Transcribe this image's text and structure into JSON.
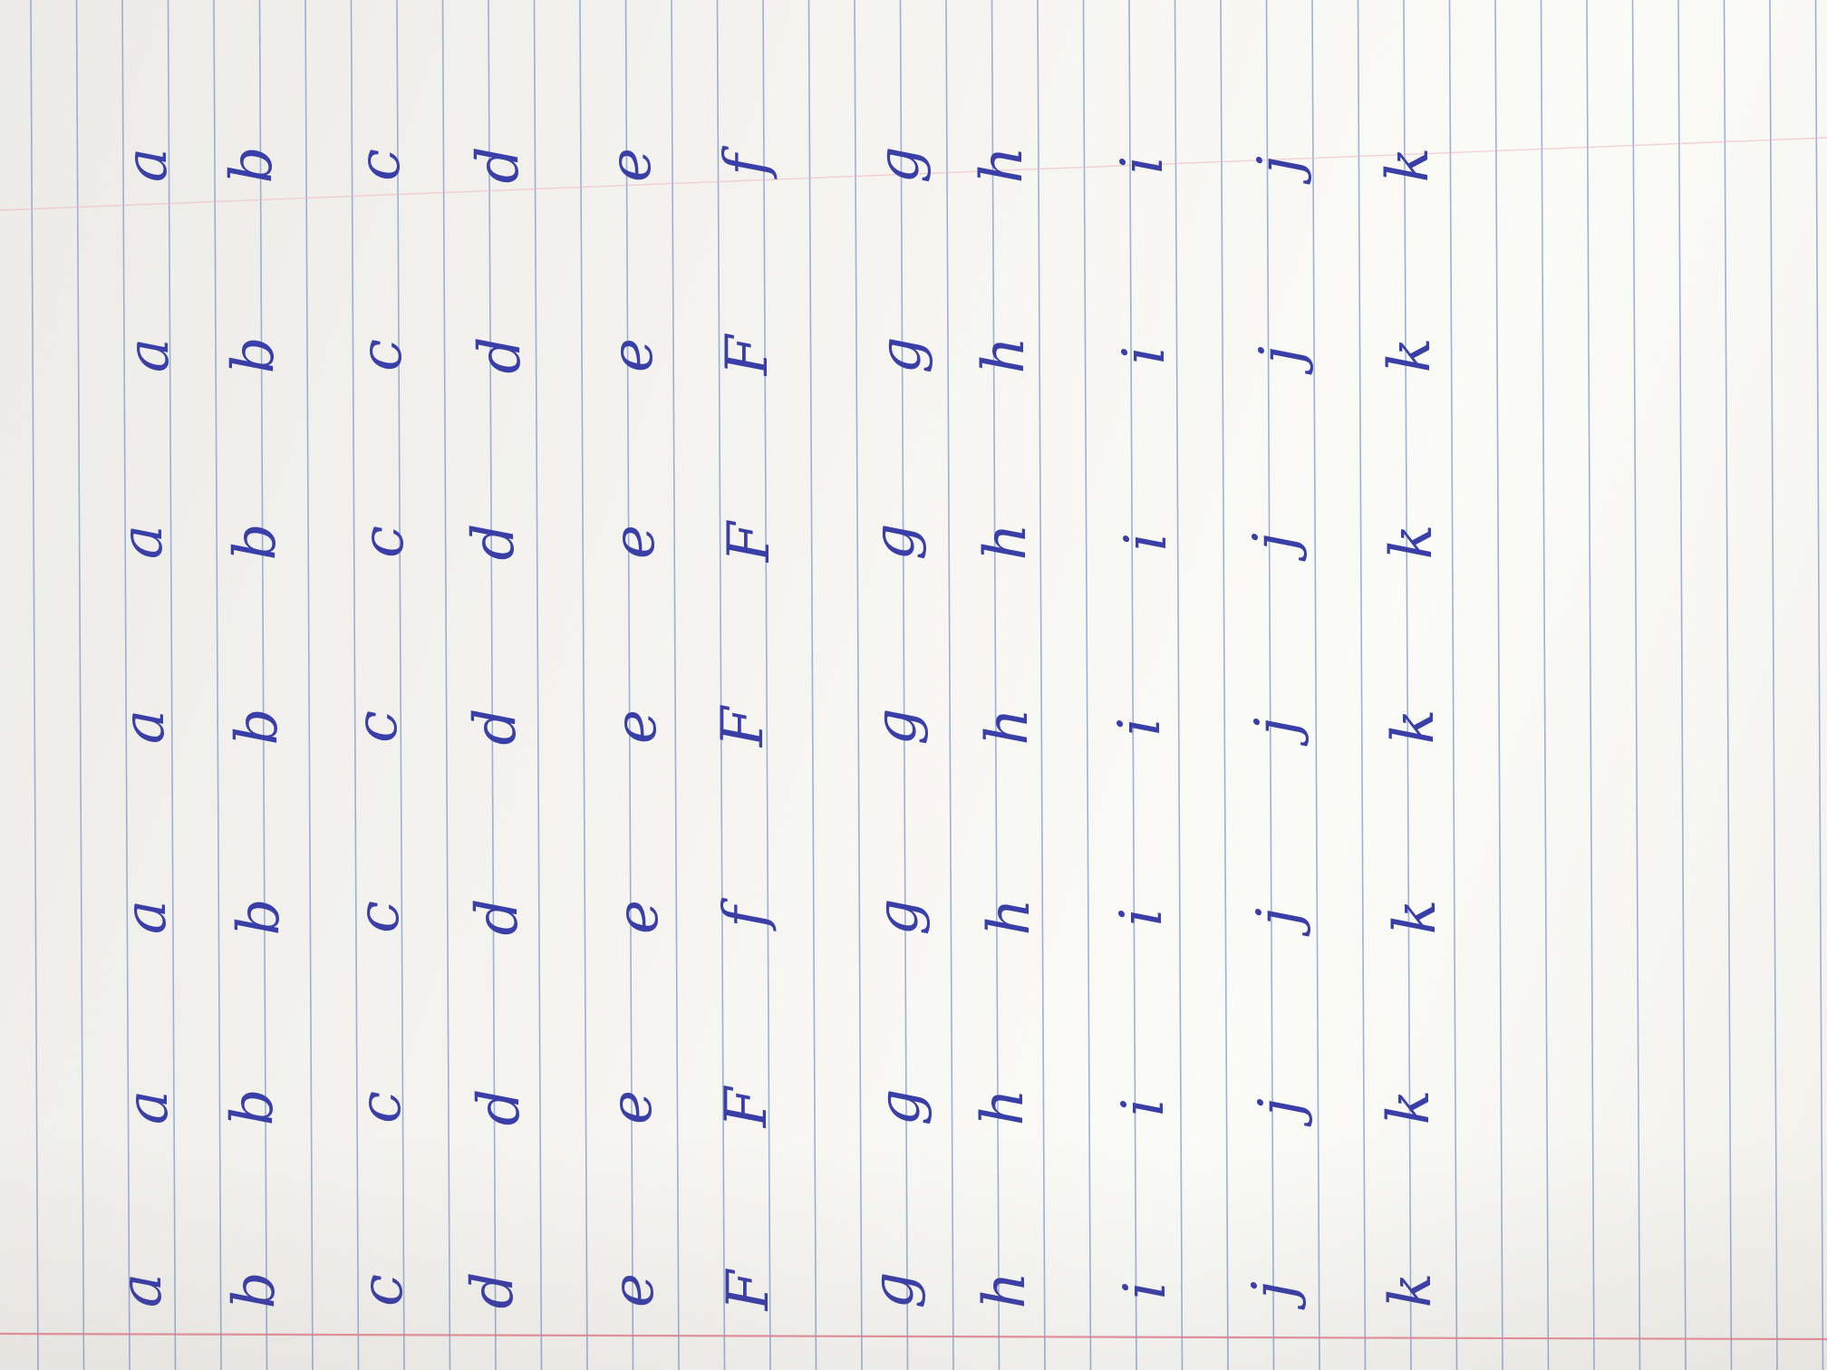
{
  "sheet": {
    "paper_color": "#f3f2ee",
    "rule_color": "#7d9bd0",
    "margin_color": "#e6838f",
    "ink_color": "#3a3fa8"
  },
  "handwriting": {
    "rotation_deg": -90,
    "rows": [
      {
        "letter": "a",
        "samples": [
          "a",
          "a",
          "a",
          "a",
          "a",
          "a",
          "a"
        ]
      },
      {
        "letter": "b",
        "samples": [
          "b",
          "b",
          "b",
          "b",
          "b",
          "b",
          "b"
        ]
      },
      {
        "letter": "c",
        "samples": [
          "c",
          "c",
          "c",
          "c",
          "c",
          "c",
          "c"
        ]
      },
      {
        "letter": "d",
        "samples": [
          "d",
          "d",
          "d",
          "d",
          "d",
          "d",
          "d"
        ]
      },
      {
        "letter": "e",
        "samples": [
          "e",
          "e",
          "e",
          "e",
          "e",
          "e",
          "e"
        ]
      },
      {
        "letter": "f",
        "samples": [
          "F",
          "F",
          "f",
          "F",
          "F",
          "F",
          "f"
        ]
      },
      {
        "letter": "g",
        "samples": [
          "g",
          "g",
          "g",
          "g",
          "g",
          "g",
          "g"
        ]
      },
      {
        "letter": "h",
        "samples": [
          "h",
          "h",
          "h",
          "h",
          "h",
          "h",
          "h"
        ]
      },
      {
        "letter": "i",
        "samples": [
          "i",
          "i",
          "i",
          "i",
          "i",
          "i",
          "i"
        ]
      },
      {
        "letter": "j",
        "samples": [
          "j",
          "j",
          "j",
          "j",
          "j",
          "j",
          "j"
        ]
      },
      {
        "letter": "k",
        "samples": [
          "k",
          "k",
          "k",
          "k",
          "k",
          "k",
          "k"
        ]
      }
    ]
  }
}
